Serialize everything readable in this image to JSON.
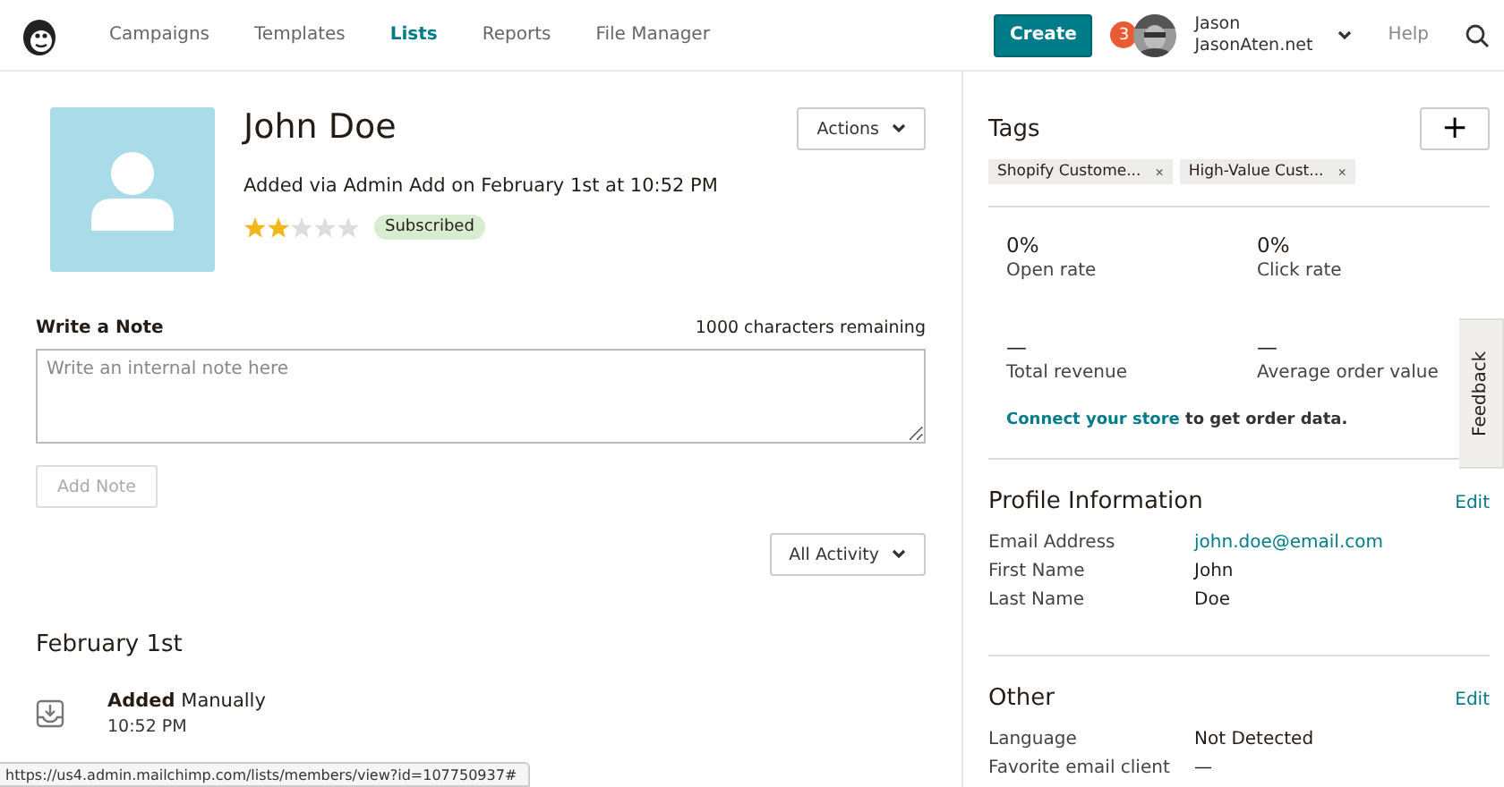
{
  "nav": {
    "items": [
      {
        "label": "Campaigns",
        "selected": false
      },
      {
        "label": "Templates",
        "selected": false
      },
      {
        "label": "Lists",
        "selected": true
      },
      {
        "label": "Reports",
        "selected": false
      },
      {
        "label": "File Manager",
        "selected": false
      }
    ],
    "create": "Create",
    "notifications": "3",
    "user_name": "Jason",
    "user_site": "JasonAten.net",
    "help": "Help"
  },
  "profile": {
    "name": "John Doe",
    "added": "Added via Admin Add on February 1st at 10:52 PM",
    "stars": 2,
    "status": "Subscribed",
    "actions": "Actions"
  },
  "note": {
    "label": "Write a Note",
    "remaining": "1000 characters remaining",
    "placeholder": "Write an internal note here",
    "button": "Add Note",
    "disabled": true
  },
  "activity": {
    "filter": "All Activity",
    "date": "February 1st",
    "events": [
      {
        "text": "**Added** Manually",
        "time": "10:52 PM"
      }
    ]
  },
  "tags": {
    "title": "Tags",
    "add": "+",
    "items": [
      {
        "label": "Shopify Custome...",
        "remove": "×"
      },
      {
        "label": "High-Value Cust...",
        "remove": "×"
      }
    ]
  },
  "stats": [
    {
      "value": "0%",
      "label": "Open rate"
    },
    {
      "value": "0%",
      "label": "Click rate"
    },
    {
      "value": "—",
      "label": "Total revenue"
    },
    {
      "value": "—",
      "label": "Average order value"
    }
  ],
  "connect": {
    "link": "Connect your store",
    "text": "to get order data."
  },
  "profile_info": {
    "title": "Profile Information",
    "edit": "Edit",
    "fields": [
      {
        "label": "Email Address",
        "value": "john.doe@email.com",
        "kind": "link"
      },
      {
        "label": "First Name",
        "value": "John",
        "kind": "plain"
      },
      {
        "label": "Last Name",
        "value": "Doe",
        "kind": "plain"
      }
    ]
  },
  "other": {
    "title": "Other",
    "edit": "Edit",
    "fields": [
      {
        "label": "Language",
        "value": "Not Detected",
        "kind": "plain"
      },
      {
        "label": "Favorite email client",
        "value": "—",
        "kind": "plain"
      }
    ]
  },
  "feedback": "Feedback",
  "status_url": "https://us4.admin.mailchimp.com/lists/members/view?id=107750937#"
}
